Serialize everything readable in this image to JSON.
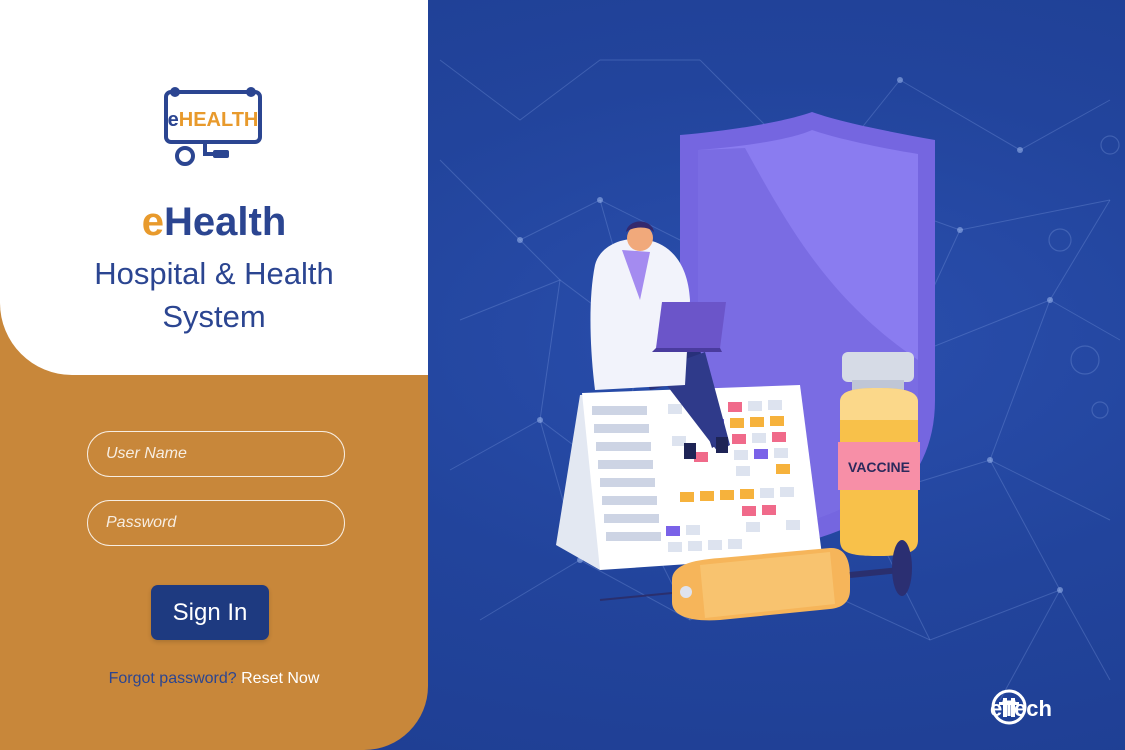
{
  "brand": {
    "logo_text_prefix": "e",
    "logo_text_rest": "HEALTH",
    "title_prefix": "e",
    "title_rest": "Health",
    "subtitle_line1": "Hospital & Health",
    "subtitle_line2": "System"
  },
  "login": {
    "username_placeholder": "User Name",
    "password_placeholder": "Password",
    "signin_label": "Sign In",
    "forgot_text": "Forgot password?",
    "reset_link": "Reset Now"
  },
  "illustration": {
    "vial_label": "VACCINE"
  },
  "footer": {
    "company": "eTech"
  },
  "colors": {
    "primary_blue": "#2b4591",
    "accent_orange": "#c8873a",
    "background_blue": "#1f3f93",
    "logo_orange": "#e89a2c"
  },
  "icons": [
    "stethoscope-logo-icon",
    "etech-logo-icon"
  ]
}
